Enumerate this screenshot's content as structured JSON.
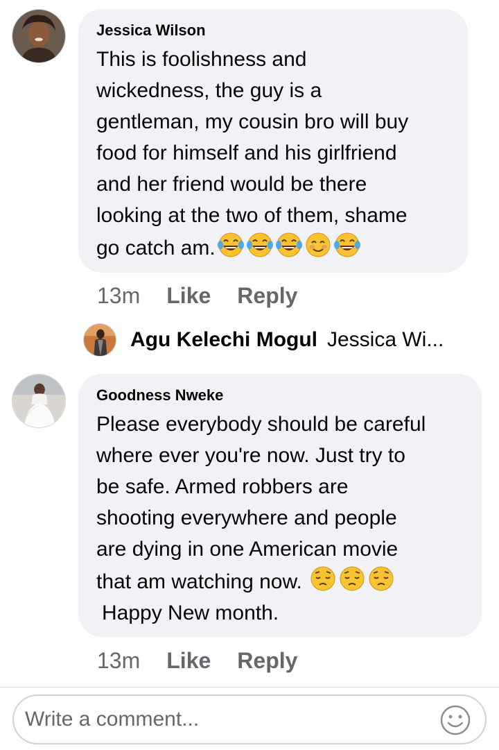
{
  "comments": [
    {
      "author": "Jessica Wilson",
      "text": "This is foolishness and\nwickedness, the guy is a\ngentleman, my cousin bro will buy\nfood for himself and his girlfriend\nand her friend would be there\nlooking at the two of them, shame\ngo catch am.",
      "emojis": [
        "tears-of-joy-emoji",
        "tears-of-joy-emoji",
        "tears-of-joy-emoji",
        "smiling-blush-emoji",
        "tears-of-joy-emoji"
      ],
      "time": "13m",
      "like_label": "Like",
      "reply_label": "Reply"
    },
    {
      "author": "Goodness Nweke",
      "text": "Please everybody should be careful\nwhere ever you're now. Just try to\nbe safe. Armed robbers are\nshooting everywhere and people\nare dying in one American movie\nthat am watching now.",
      "emojis": [
        "pensive-emoji",
        "pensive-emoji",
        "pensive-emoji"
      ],
      "text_after": "Happy New month.",
      "time": "13m",
      "like_label": "Like",
      "reply_label": "Reply"
    }
  ],
  "reply_preview": {
    "author": "Agu Kelechi Mogul",
    "text": "Jessica Wi..."
  },
  "composer": {
    "placeholder": "Write a comment...",
    "emoji_icon": "smiley-icon"
  },
  "colors": {
    "bubble": "#f0f2f5",
    "meta_text": "#65676b",
    "text": "#050505"
  }
}
